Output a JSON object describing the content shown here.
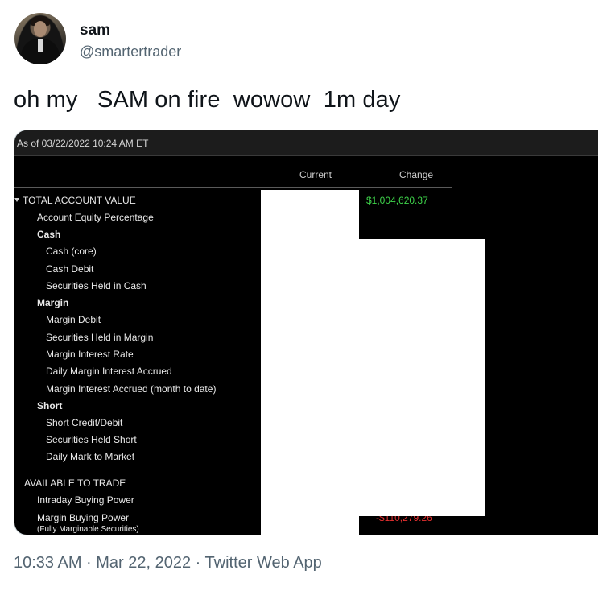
{
  "tweet": {
    "display_name": "sam",
    "handle": "@smartertrader",
    "text": "oh my   SAM on fire  wowow  1m day",
    "timestamp": "10:33 AM · Mar 22, 2022 · Twitter Web App"
  },
  "media": {
    "as_of": "As of 03/22/2022 10:24 AM ET",
    "columns": {
      "current": "Current",
      "change": "Change"
    },
    "rows": [
      {
        "label": "TOTAL ACCOUNT VALUE",
        "bold": false
      },
      {
        "label": "Account Equity Percentage"
      },
      {
        "label": "Cash",
        "bold": true
      },
      {
        "label": "Cash (core)"
      },
      {
        "label": "Cash Debit"
      },
      {
        "label": "Securities Held in Cash"
      },
      {
        "label": "Margin",
        "bold": true
      },
      {
        "label": "Margin Debit"
      },
      {
        "label": "Securities Held in Margin"
      },
      {
        "label": "Margin Interest Rate"
      },
      {
        "label": "Daily Margin Interest Accrued"
      },
      {
        "label": "Margin Interest Accrued (month to date)"
      },
      {
        "label": "Short",
        "bold": true
      },
      {
        "label": "Short Credit/Debit"
      },
      {
        "label": "Securities Held Short"
      },
      {
        "label": "Daily Mark to Market"
      },
      {
        "label": "AVAILABLE TO TRADE"
      },
      {
        "label": "Intraday Buying Power"
      },
      {
        "label": "Margin Buying Power"
      },
      {
        "label": "(Fully Marginable Securities)"
      }
    ],
    "total_change": "$1,004,620.37",
    "margin_bp_change_partial": "-$110,279.26",
    "colors": {
      "positive": "#3ed34a",
      "negative": "#e53030",
      "background": "#000000"
    }
  }
}
